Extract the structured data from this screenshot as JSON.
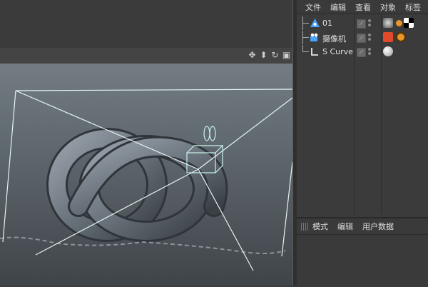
{
  "object_manager": {
    "menu": [
      "文件",
      "编辑",
      "查看",
      "对象",
      "标签"
    ],
    "objects": [
      {
        "name": "01",
        "icon": "cloner-icon"
      },
      {
        "name": "摄像机",
        "icon": "camera-icon"
      },
      {
        "name": "S Curve",
        "icon": "spline-icon"
      }
    ]
  },
  "attribute_manager": {
    "menu": [
      "模式",
      "编辑",
      "用户数据"
    ]
  },
  "viewport": {
    "nav_icons": [
      "move-view-icon",
      "dolly-view-icon",
      "rotate-view-icon",
      "maximize-view-icon"
    ]
  },
  "colors": {
    "accent_blue": "#4aa3ff",
    "tag_red": "#e04a2a",
    "tag_orange": "#e8962a"
  }
}
